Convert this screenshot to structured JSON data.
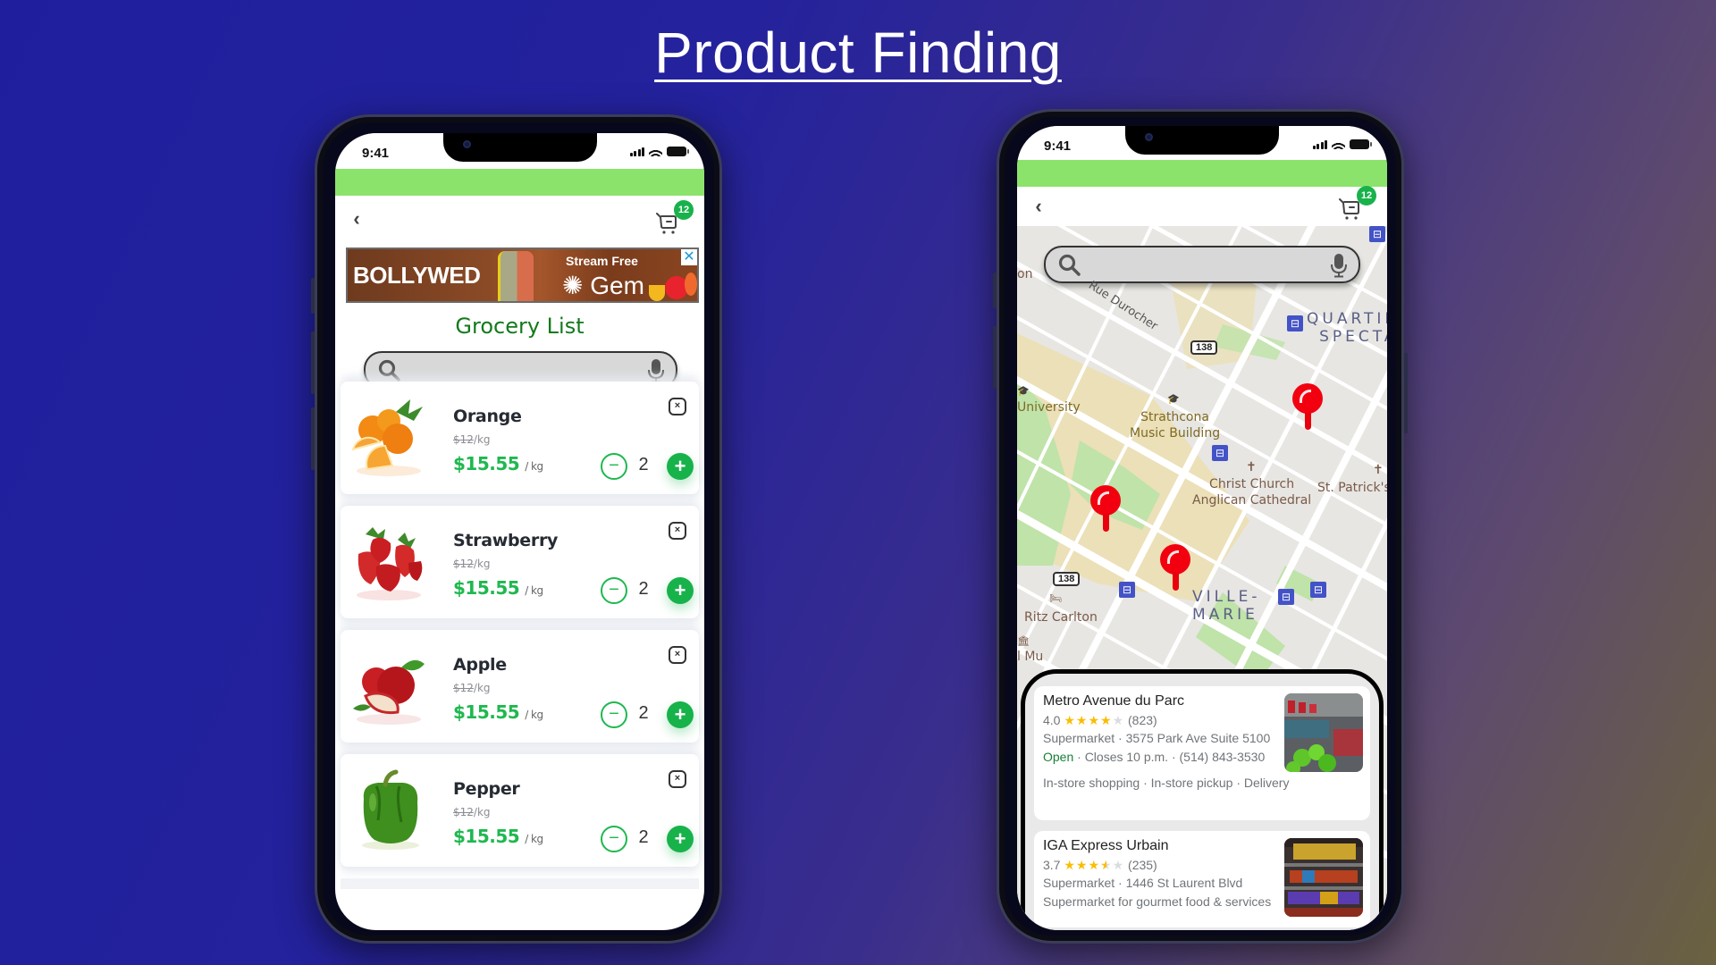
{
  "page": {
    "title": "Product Finding"
  },
  "status_bar": {
    "time": "9:41"
  },
  "cart": {
    "badge_count": "12"
  },
  "grocery_screen": {
    "ad": {
      "brand": "BOLLYWED",
      "tagline": "Stream Free",
      "network": "Gem",
      "close_label": "✕"
    },
    "title": "Grocery List",
    "search": {
      "placeholder": "",
      "value": ""
    },
    "products": [
      {
        "name": "Orange",
        "old_price": "$12",
        "old_unit": "/kg",
        "price": "$15.55",
        "unit": "/ kg",
        "quantity": "2",
        "image": "orange"
      },
      {
        "name": "Strawberry",
        "old_price": "$12",
        "old_unit": "/kg",
        "price": "$15.55",
        "unit": "/ kg",
        "quantity": "2",
        "image": "strawberry"
      },
      {
        "name": "Apple",
        "old_price": "$12",
        "old_unit": "/kg",
        "price": "$15.55",
        "unit": "/ kg",
        "quantity": "2",
        "image": "apple"
      },
      {
        "name": "Pepper",
        "old_price": "$12",
        "old_unit": "/kg",
        "price": "$15.55",
        "unit": "/ kg",
        "quantity": "2",
        "image": "pepper"
      }
    ],
    "controls": {
      "minus": "−",
      "plus": "+",
      "remove": "×",
      "back": "‹"
    }
  },
  "map_screen": {
    "search": {
      "placeholder": "",
      "value": ""
    },
    "labels": {
      "partial_left": "on",
      "street": "Rue Durocher",
      "university": "University",
      "strathcona": "Strathcona\nMusic Building",
      "church": "Christ Church\nAnglican Cathedral",
      "st_patricks": "St. Patrick's",
      "ritz": "Ritz Carlton",
      "museum_partial": "l Mu",
      "quartier": "QUARTIER\nSPECTAC",
      "ville_marie": "VILLE-\nMARIE"
    },
    "route_shields": [
      "138",
      "138"
    ],
    "pins": 3,
    "results": [
      {
        "name": "Metro Avenue du Parc",
        "rating": "4.0",
        "stars": 4.0,
        "reviews": "(823)",
        "category_address": "Supermarket · 3575 Park Ave Suite 5100",
        "open_status": "Open",
        "hours_phone": " · Closes 10 p.m. · (514) 843-3530",
        "services": "In-store shopping · In-store pickup · Delivery"
      },
      {
        "name": "IGA Express Urbain",
        "rating": "3.7",
        "stars": 3.5,
        "reviews": "(235)",
        "category_address": "Supermarket · 1446 St Laurent Blvd",
        "description": "Supermarket for gourmet food & services"
      }
    ]
  },
  "colors": {
    "accent_green": "#18b24b",
    "header_green": "#8ce36c",
    "title_green": "#137a1c",
    "pin_red": "#f2000f",
    "star_yellow": "#fbbc04"
  }
}
